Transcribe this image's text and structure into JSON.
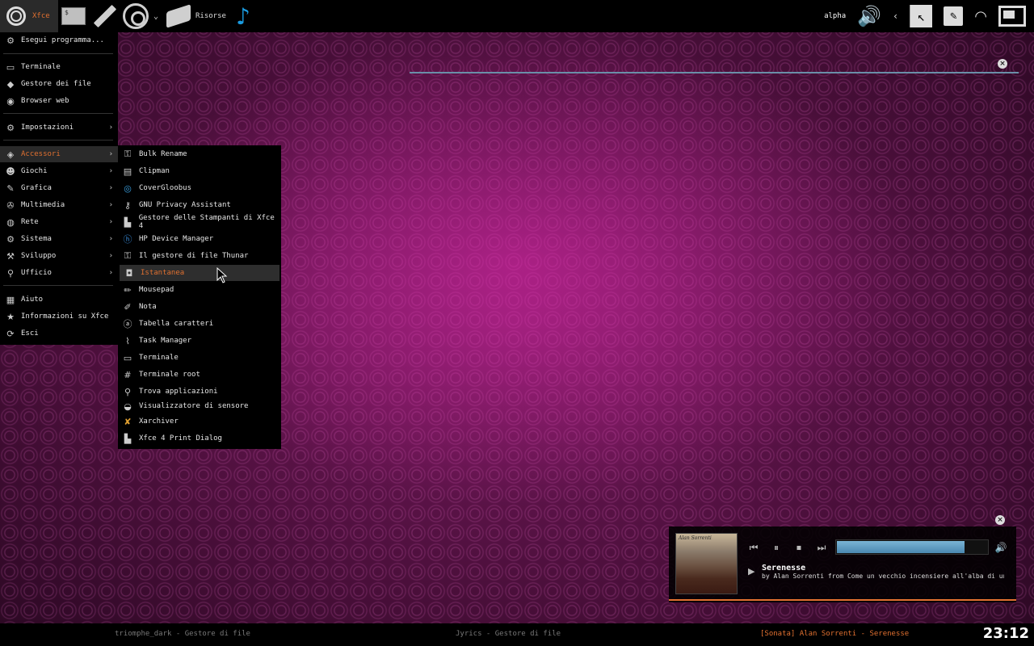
{
  "top_panel": {
    "menu_button_label": "Xfce",
    "terminal_prompt": "$",
    "resources_label": "Risorse",
    "tray_user": "alpha",
    "tray_chevron": "‹"
  },
  "app_menu": {
    "items": [
      {
        "label": "Esegui programma...",
        "icon": "run-icon"
      },
      {
        "label": "Terminale",
        "icon": "terminal-icon"
      },
      {
        "label": "Gestore dei file",
        "icon": "file-manager-icon"
      },
      {
        "label": "Browser web",
        "icon": "web-browser-icon"
      },
      {
        "label": "Impostazioni",
        "icon": "settings-icon",
        "submenu": true
      },
      {
        "label": "Accessori",
        "icon": "accessories-icon",
        "submenu": true,
        "active": true
      },
      {
        "label": "Giochi",
        "icon": "games-icon",
        "submenu": true
      },
      {
        "label": "Grafica",
        "icon": "graphics-icon",
        "submenu": true
      },
      {
        "label": "Multimedia",
        "icon": "multimedia-icon",
        "submenu": true
      },
      {
        "label": "Rete",
        "icon": "network-icon",
        "submenu": true
      },
      {
        "label": "Sistema",
        "icon": "system-icon",
        "submenu": true
      },
      {
        "label": "Sviluppo",
        "icon": "development-icon",
        "submenu": true
      },
      {
        "label": "Ufficio",
        "icon": "office-icon",
        "submenu": true
      },
      {
        "label": "Aiuto",
        "icon": "help-icon"
      },
      {
        "label": "Informazioni su Xfce",
        "icon": "about-icon"
      },
      {
        "label": "Esci",
        "icon": "logout-icon"
      }
    ]
  },
  "accessori_submenu": {
    "items": [
      {
        "label": "Bulk Rename",
        "icon": "bulk-rename-icon"
      },
      {
        "label": "Clipman",
        "icon": "clipboard-icon"
      },
      {
        "label": "CoverGloobus",
        "icon": "covergloobus-icon"
      },
      {
        "label": "GNU Privacy Assistant",
        "icon": "key-icon"
      },
      {
        "label": "Gestore delle Stampanti di Xfce 4",
        "icon": "printer-icon"
      },
      {
        "label": "HP Device Manager",
        "icon": "hp-icon"
      },
      {
        "label": "Il gestore di file Thunar",
        "icon": "thunar-icon"
      },
      {
        "label": "Istantanea",
        "icon": "camera-icon",
        "hover": true
      },
      {
        "label": "Mousepad",
        "icon": "pencil-icon"
      },
      {
        "label": "Nota",
        "icon": "note-icon"
      },
      {
        "label": "Tabella caratteri",
        "icon": "charmap-icon"
      },
      {
        "label": "Task Manager",
        "icon": "task-manager-icon"
      },
      {
        "label": "Terminale",
        "icon": "terminal-icon"
      },
      {
        "label": "Terminale root",
        "icon": "root-terminal-icon"
      },
      {
        "label": "Trova applicazioni",
        "icon": "search-icon"
      },
      {
        "label": "Visualizzatore di sensore",
        "icon": "sensor-icon"
      },
      {
        "label": "Xarchiver",
        "icon": "archive-icon"
      },
      {
        "label": "Xfce 4 Print Dialog",
        "icon": "print-dialog-icon"
      }
    ]
  },
  "player": {
    "album_caption": "Alan Sorrenti",
    "song_title": "Serenesse",
    "song_info": "by Alan Sorrenti from Come un vecchio incensiere all'alba di un vil...",
    "progress_fraction": 0.85,
    "close_glyph": "×"
  },
  "notification": {
    "close_glyph": "×"
  },
  "taskbar": {
    "tasks": [
      {
        "label": "triomphe_dark - Gestore di file",
        "active": false
      },
      {
        "label": "Jyrics - Gestore di file",
        "active": false
      },
      {
        "label": "[Sonata] Alan Sorrenti - Serenesse",
        "active": true
      }
    ],
    "clock": "23:12"
  },
  "colors": {
    "accent": "#e07030",
    "progress": "#5a9cc4",
    "launcher_note": "#1a9be0"
  }
}
